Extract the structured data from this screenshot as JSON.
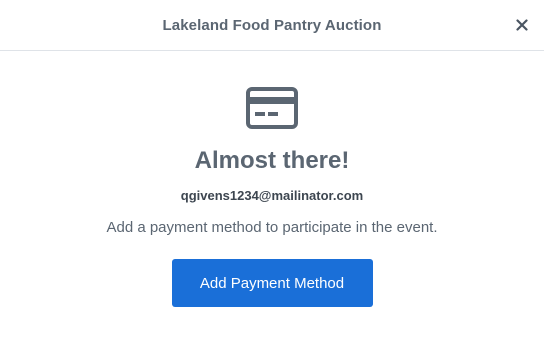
{
  "modal": {
    "title": "Lakeland Food Pantry Auction",
    "close_icon": "close-icon"
  },
  "content": {
    "icon": "credit-card-icon",
    "heading": "Almost there!",
    "email": "qgivens1234@mailinator.com",
    "message": "Add a payment method to participate in the event.",
    "button_label": "Add Payment Method"
  },
  "colors": {
    "primary": "#1a6fd8",
    "heading_text": "#5b6672",
    "icon": "#5b6672",
    "divider": "#dfe3e8"
  }
}
